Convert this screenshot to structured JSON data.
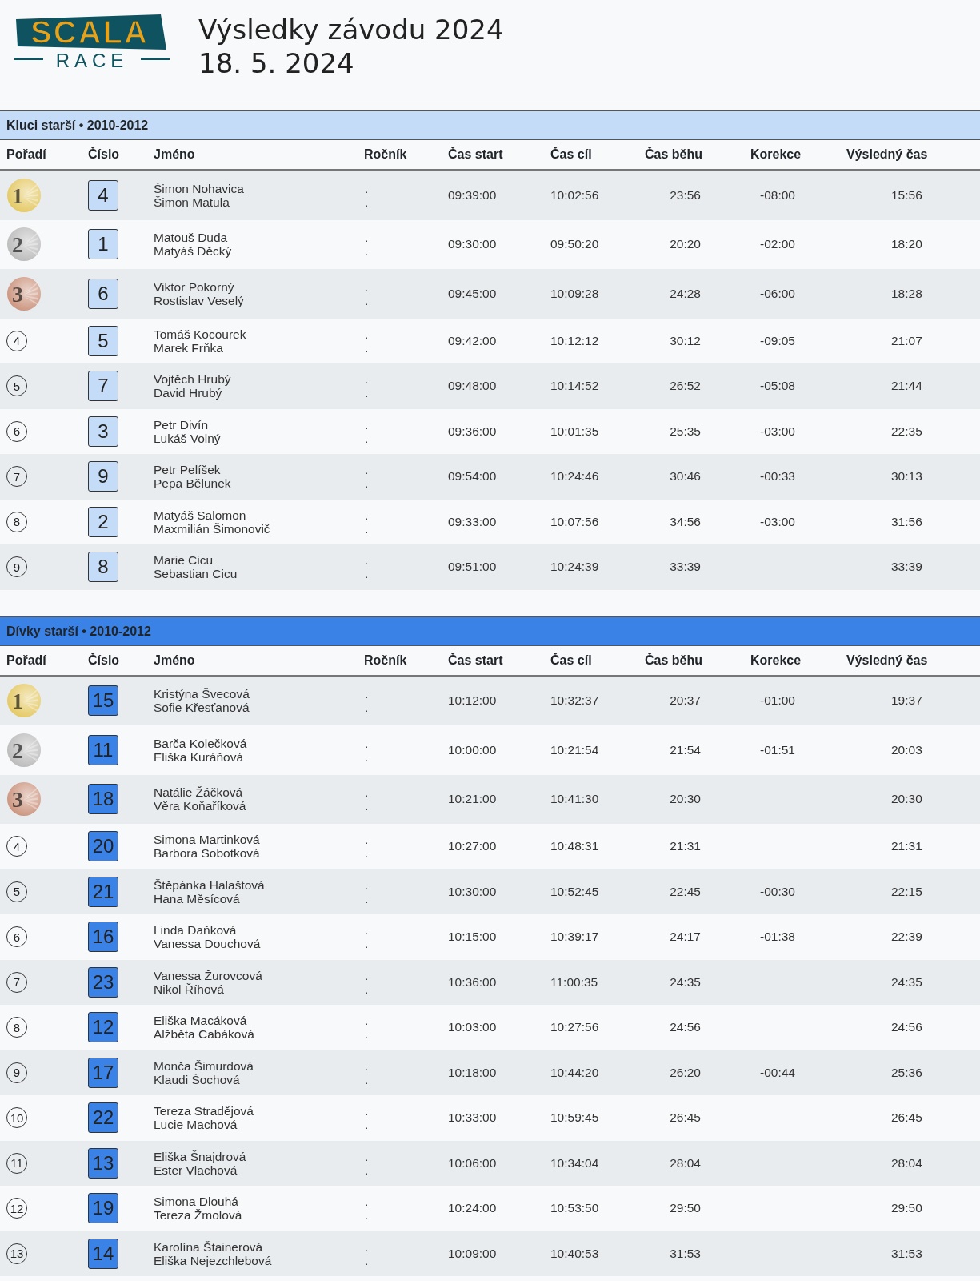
{
  "logo": {
    "top": "SCALA",
    "bottom": "RACE"
  },
  "title": "Výsledky závodu 2024",
  "date": "18. 5. 2024",
  "categories": [
    {
      "title": "Kluci starší • 2010-2012",
      "color": "#c5dcf8",
      "columns": [
        "Pořadí",
        "Číslo",
        "Jméno",
        "Ročník",
        "Čas start",
        "Čas cíl",
        "Čas běhu",
        "Korekce",
        "Výsledný čas"
      ],
      "rows": [
        {
          "rank": "1",
          "color": "#e3c65c",
          "number": "4",
          "names": [
            "Šimon Nohavica",
            "Šimon Matula"
          ],
          "years": [
            ".",
            "."
          ],
          "start": "09:39:00",
          "finish": "10:02:56",
          "run": "23:56",
          "correction": "-08:00",
          "result": "15:56"
        },
        {
          "rank": "2",
          "color": "#b8b8b8",
          "number": "1",
          "names": [
            "Matouš Duda",
            "Matyáš Děcký"
          ],
          "years": [
            ".",
            "."
          ],
          "start": "09:30:00",
          "finish": "09:50:20",
          "run": "20:20",
          "correction": "-02:00",
          "result": "18:20"
        },
        {
          "rank": "3",
          "color": "#c98f78",
          "number": "6",
          "names": [
            "Viktor Pokorný",
            "Rostislav Veselý"
          ],
          "years": [
            ".",
            "."
          ],
          "start": "09:45:00",
          "finish": "10:09:28",
          "run": "24:28",
          "correction": "-06:00",
          "result": "18:28"
        },
        {
          "rank": "4",
          "number": "5",
          "names": [
            "Tomáš Kocourek",
            "Marek Frňka"
          ],
          "years": [
            ".",
            "."
          ],
          "start": "09:42:00",
          "finish": "10:12:12",
          "run": "30:12",
          "correction": "-09:05",
          "result": "21:07"
        },
        {
          "rank": "5",
          "number": "7",
          "names": [
            "Vojtěch Hrubý",
            "David Hrubý"
          ],
          "years": [
            ".",
            "."
          ],
          "start": "09:48:00",
          "finish": "10:14:52",
          "run": "26:52",
          "correction": "-05:08",
          "result": "21:44"
        },
        {
          "rank": "6",
          "number": "3",
          "names": [
            "Petr Divín",
            "Lukáš Volný"
          ],
          "years": [
            ".",
            "."
          ],
          "start": "09:36:00",
          "finish": "10:01:35",
          "run": "25:35",
          "correction": "-03:00",
          "result": "22:35"
        },
        {
          "rank": "7",
          "number": "9",
          "names": [
            "Petr Pelíšek",
            "Pepa Bělunek"
          ],
          "years": [
            ".",
            "."
          ],
          "start": "09:54:00",
          "finish": "10:24:46",
          "run": "30:46",
          "correction": "-00:33",
          "result": "30:13"
        },
        {
          "rank": "8",
          "number": "2",
          "names": [
            "Matyáš Salomon",
            "Maxmilián Šimonovič"
          ],
          "years": [
            ".",
            "."
          ],
          "start": "09:33:00",
          "finish": "10:07:56",
          "run": "34:56",
          "correction": "-03:00",
          "result": "31:56"
        },
        {
          "rank": "9",
          "number": "8",
          "names": [
            "Marie Cicu",
            "Sebastian Cicu"
          ],
          "years": [
            ".",
            "."
          ],
          "start": "09:51:00",
          "finish": "10:24:39",
          "run": "33:39",
          "result": "33:39"
        }
      ]
    },
    {
      "title": "Dívky starší • 2010-2012",
      "color": "#3b82e6",
      "columns": [
        "Pořadí",
        "Číslo",
        "Jméno",
        "Ročník",
        "Čas start",
        "Čas cíl",
        "Čas běhu",
        "Korekce",
        "Výsledný čas"
      ],
      "rows": [
        {
          "rank": "1",
          "color": "#e3c65c",
          "number": "15",
          "names": [
            "Kristýna Švecová",
            "Sofie Křesťanová"
          ],
          "years": [
            ".",
            "."
          ],
          "start": "10:12:00",
          "finish": "10:32:37",
          "run": "20:37",
          "correction": "-01:00",
          "result": "19:37"
        },
        {
          "rank": "2",
          "color": "#b8b8b8",
          "number": "11",
          "names": [
            "Barča Kolečková",
            "Eliška Kuráňová"
          ],
          "years": [
            ".",
            "."
          ],
          "start": "10:00:00",
          "finish": "10:21:54",
          "run": "21:54",
          "correction": "-01:51",
          "result": "20:03"
        },
        {
          "rank": "3",
          "color": "#c98f78",
          "number": "18",
          "names": [
            "Natálie Žáčková",
            "Věra Koňaříková"
          ],
          "years": [
            ".",
            "."
          ],
          "start": "10:21:00",
          "finish": "10:41:30",
          "run": "20:30",
          "result": "20:30"
        },
        {
          "rank": "4",
          "number": "20",
          "names": [
            "Simona Martinková",
            "Barbora Sobotková"
          ],
          "years": [
            ".",
            "."
          ],
          "start": "10:27:00",
          "finish": "10:48:31",
          "run": "21:31",
          "result": "21:31"
        },
        {
          "rank": "5",
          "number": "21",
          "names": [
            "Štěpánka Halaštová",
            "Hana Měsícová"
          ],
          "years": [
            ".",
            "."
          ],
          "start": "10:30:00",
          "finish": "10:52:45",
          "run": "22:45",
          "correction": "-00:30",
          "result": "22:15"
        },
        {
          "rank": "6",
          "number": "16",
          "names": [
            "Linda Daňková",
            "Vanessa Douchová"
          ],
          "years": [
            ".",
            "."
          ],
          "start": "10:15:00",
          "finish": "10:39:17",
          "run": "24:17",
          "correction": "-01:38",
          "result": "22:39"
        },
        {
          "rank": "7",
          "number": "23",
          "names": [
            "Vanessa Žurovcová",
            "Nikol Říhová"
          ],
          "years": [
            ".",
            "."
          ],
          "start": "10:36:00",
          "finish": "11:00:35",
          "run": "24:35",
          "result": "24:35"
        },
        {
          "rank": "8",
          "number": "12",
          "names": [
            "Eliška Macáková",
            "Alžběta Cabáková"
          ],
          "years": [
            ".",
            "."
          ],
          "start": "10:03:00",
          "finish": "10:27:56",
          "run": "24:56",
          "result": "24:56"
        },
        {
          "rank": "9",
          "number": "17",
          "names": [
            "Monča Šimurdová",
            "Klaudi Šochová"
          ],
          "years": [
            ".",
            "."
          ],
          "start": "10:18:00",
          "finish": "10:44:20",
          "run": "26:20",
          "correction": "-00:44",
          "result": "25:36"
        },
        {
          "rank": "10",
          "number": "22",
          "names": [
            "Tereza Stradějová",
            "Lucie Machová"
          ],
          "years": [
            ".",
            "."
          ],
          "start": "10:33:00",
          "finish": "10:59:45",
          "run": "26:45",
          "result": "26:45"
        },
        {
          "rank": "11",
          "number": "13",
          "names": [
            "Eliška Šnajdrová",
            "Ester Vlachová"
          ],
          "years": [
            ".",
            "."
          ],
          "start": "10:06:00",
          "finish": "10:34:04",
          "run": "28:04",
          "result": "28:04"
        },
        {
          "rank": "12",
          "number": "19",
          "names": [
            "Simona Dlouhá",
            "Tereza Žmolová"
          ],
          "years": [
            ".",
            "."
          ],
          "start": "10:24:00",
          "finish": "10:53:50",
          "run": "29:50",
          "result": "29:50"
        },
        {
          "rank": "13",
          "number": "14",
          "names": [
            "Karolína Štainerová",
            "Eliška Nejezchlebová"
          ],
          "years": [
            ".",
            "."
          ],
          "start": "10:09:00",
          "finish": "10:40:53",
          "run": "31:53",
          "result": "31:53"
        }
      ]
    }
  ]
}
